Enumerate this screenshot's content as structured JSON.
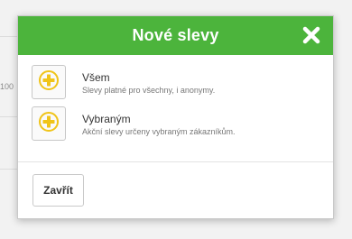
{
  "background": {
    "partial_text": "100"
  },
  "dialog": {
    "title": "Nové slevy",
    "close_icon": "close-x-icon",
    "options": [
      {
        "icon": "plus-circle-icon",
        "title": "Všem",
        "description": "Slevy platné pro všechny, i anonymy."
      },
      {
        "icon": "plus-circle-icon",
        "title": "Vybraným",
        "description": "Akční slevy určeny vybraným zákazníkům."
      }
    ],
    "close_button_label": "Zavřít"
  },
  "colors": {
    "header": "#4cb43c",
    "plus_icon": "#f0c419"
  }
}
